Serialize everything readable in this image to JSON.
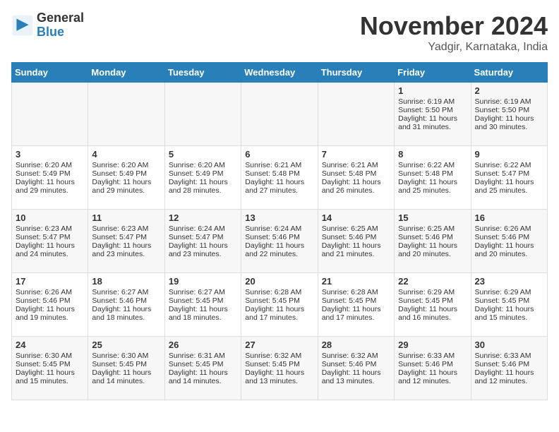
{
  "header": {
    "logo_general": "General",
    "logo_blue": "Blue",
    "month_title": "November 2024",
    "location": "Yadgir, Karnataka, India"
  },
  "days_of_week": [
    "Sunday",
    "Monday",
    "Tuesday",
    "Wednesday",
    "Thursday",
    "Friday",
    "Saturday"
  ],
  "weeks": [
    [
      {
        "day": "",
        "info": ""
      },
      {
        "day": "",
        "info": ""
      },
      {
        "day": "",
        "info": ""
      },
      {
        "day": "",
        "info": ""
      },
      {
        "day": "",
        "info": ""
      },
      {
        "day": "1",
        "info": "Sunrise: 6:19 AM\nSunset: 5:50 PM\nDaylight: 11 hours and 31 minutes."
      },
      {
        "day": "2",
        "info": "Sunrise: 6:19 AM\nSunset: 5:50 PM\nDaylight: 11 hours and 30 minutes."
      }
    ],
    [
      {
        "day": "3",
        "info": "Sunrise: 6:20 AM\nSunset: 5:49 PM\nDaylight: 11 hours and 29 minutes."
      },
      {
        "day": "4",
        "info": "Sunrise: 6:20 AM\nSunset: 5:49 PM\nDaylight: 11 hours and 29 minutes."
      },
      {
        "day": "5",
        "info": "Sunrise: 6:20 AM\nSunset: 5:49 PM\nDaylight: 11 hours and 28 minutes."
      },
      {
        "day": "6",
        "info": "Sunrise: 6:21 AM\nSunset: 5:48 PM\nDaylight: 11 hours and 27 minutes."
      },
      {
        "day": "7",
        "info": "Sunrise: 6:21 AM\nSunset: 5:48 PM\nDaylight: 11 hours and 26 minutes."
      },
      {
        "day": "8",
        "info": "Sunrise: 6:22 AM\nSunset: 5:48 PM\nDaylight: 11 hours and 25 minutes."
      },
      {
        "day": "9",
        "info": "Sunrise: 6:22 AM\nSunset: 5:47 PM\nDaylight: 11 hours and 25 minutes."
      }
    ],
    [
      {
        "day": "10",
        "info": "Sunrise: 6:23 AM\nSunset: 5:47 PM\nDaylight: 11 hours and 24 minutes."
      },
      {
        "day": "11",
        "info": "Sunrise: 6:23 AM\nSunset: 5:47 PM\nDaylight: 11 hours and 23 minutes."
      },
      {
        "day": "12",
        "info": "Sunrise: 6:24 AM\nSunset: 5:47 PM\nDaylight: 11 hours and 23 minutes."
      },
      {
        "day": "13",
        "info": "Sunrise: 6:24 AM\nSunset: 5:46 PM\nDaylight: 11 hours and 22 minutes."
      },
      {
        "day": "14",
        "info": "Sunrise: 6:25 AM\nSunset: 5:46 PM\nDaylight: 11 hours and 21 minutes."
      },
      {
        "day": "15",
        "info": "Sunrise: 6:25 AM\nSunset: 5:46 PM\nDaylight: 11 hours and 20 minutes."
      },
      {
        "day": "16",
        "info": "Sunrise: 6:26 AM\nSunset: 5:46 PM\nDaylight: 11 hours and 20 minutes."
      }
    ],
    [
      {
        "day": "17",
        "info": "Sunrise: 6:26 AM\nSunset: 5:46 PM\nDaylight: 11 hours and 19 minutes."
      },
      {
        "day": "18",
        "info": "Sunrise: 6:27 AM\nSunset: 5:46 PM\nDaylight: 11 hours and 18 minutes."
      },
      {
        "day": "19",
        "info": "Sunrise: 6:27 AM\nSunset: 5:45 PM\nDaylight: 11 hours and 18 minutes."
      },
      {
        "day": "20",
        "info": "Sunrise: 6:28 AM\nSunset: 5:45 PM\nDaylight: 11 hours and 17 minutes."
      },
      {
        "day": "21",
        "info": "Sunrise: 6:28 AM\nSunset: 5:45 PM\nDaylight: 11 hours and 17 minutes."
      },
      {
        "day": "22",
        "info": "Sunrise: 6:29 AM\nSunset: 5:45 PM\nDaylight: 11 hours and 16 minutes."
      },
      {
        "day": "23",
        "info": "Sunrise: 6:29 AM\nSunset: 5:45 PM\nDaylight: 11 hours and 15 minutes."
      }
    ],
    [
      {
        "day": "24",
        "info": "Sunrise: 6:30 AM\nSunset: 5:45 PM\nDaylight: 11 hours and 15 minutes."
      },
      {
        "day": "25",
        "info": "Sunrise: 6:30 AM\nSunset: 5:45 PM\nDaylight: 11 hours and 14 minutes."
      },
      {
        "day": "26",
        "info": "Sunrise: 6:31 AM\nSunset: 5:45 PM\nDaylight: 11 hours and 14 minutes."
      },
      {
        "day": "27",
        "info": "Sunrise: 6:32 AM\nSunset: 5:45 PM\nDaylight: 11 hours and 13 minutes."
      },
      {
        "day": "28",
        "info": "Sunrise: 6:32 AM\nSunset: 5:46 PM\nDaylight: 11 hours and 13 minutes."
      },
      {
        "day": "29",
        "info": "Sunrise: 6:33 AM\nSunset: 5:46 PM\nDaylight: 11 hours and 12 minutes."
      },
      {
        "day": "30",
        "info": "Sunrise: 6:33 AM\nSunset: 5:46 PM\nDaylight: 11 hours and 12 minutes."
      }
    ]
  ]
}
